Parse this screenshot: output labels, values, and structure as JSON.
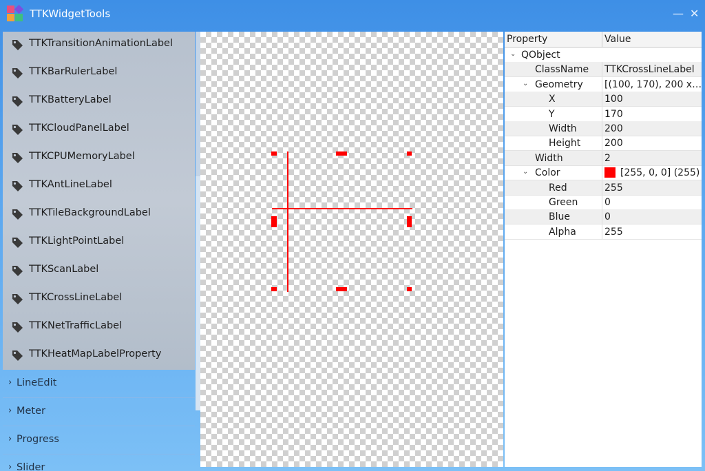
{
  "window": {
    "title": "TTKWidgetTools",
    "minimize_glyph": "—",
    "close_glyph": "✕",
    "app_icon_colors": [
      "#e84f7d",
      "#7b4fe0",
      "#f2a23a",
      "#3fbf7f"
    ]
  },
  "widget_list": {
    "items": [
      {
        "label": "TTKTransitionAnimationLabel",
        "icon": "tag-icon"
      },
      {
        "label": "TTKBarRulerLabel",
        "icon": "tag-icon"
      },
      {
        "label": "TTKBatteryLabel",
        "icon": "tag-icon"
      },
      {
        "label": "TTKCloudPanelLabel",
        "icon": "tag-icon"
      },
      {
        "label": "TTKCPUMemoryLabel",
        "icon": "tag-icon"
      },
      {
        "label": "TTKAntLineLabel",
        "icon": "tag-icon"
      },
      {
        "label": "TTKTileBackgroundLabel",
        "icon": "tag-icon"
      },
      {
        "label": "TTKLightPointLabel",
        "icon": "tag-icon"
      },
      {
        "label": "TTKScanLabel",
        "icon": "tag-icon"
      },
      {
        "label": "TTKCrossLineLabel",
        "icon": "tag-icon"
      },
      {
        "label": "TTKNetTrafficLabel",
        "icon": "tag-icon"
      },
      {
        "label": "TTKHeatMapLabelProperty",
        "icon": "tag-icon"
      }
    ],
    "categories": [
      {
        "label": "LineEdit",
        "icon": "chevron-right-icon"
      },
      {
        "label": "Meter",
        "icon": "chevron-right-icon"
      },
      {
        "label": "Progress",
        "icon": "chevron-right-icon"
      },
      {
        "label": "Slider",
        "icon": "chevron-right-icon"
      }
    ]
  },
  "canvas": {
    "widget": "TTKCrossLineLabel",
    "line_color": "#ff0000"
  },
  "properties": {
    "header": {
      "property": "Property",
      "value": "Value"
    },
    "rows": [
      {
        "name": "QObject",
        "value": "",
        "arrow": "⌄"
      },
      {
        "name": "ClassName",
        "value": "TTKCrossLineLabel"
      },
      {
        "name": "Geometry",
        "value": "[(100, 170), 200 x…",
        "arrow": "⌄"
      },
      {
        "name": "X",
        "value": "100"
      },
      {
        "name": "Y",
        "value": "170"
      },
      {
        "name": "Width",
        "value": "200"
      },
      {
        "name": "Height",
        "value": "200"
      },
      {
        "name": "Width",
        "value": "2"
      },
      {
        "name": "Color",
        "value": "[255, 0, 0] (255)",
        "arrow": "⌄",
        "swatch": "#ff0000"
      },
      {
        "name": "Red",
        "value": "255"
      },
      {
        "name": "Green",
        "value": "0"
      },
      {
        "name": "Blue",
        "value": "0"
      },
      {
        "name": "Alpha",
        "value": "255"
      }
    ]
  }
}
